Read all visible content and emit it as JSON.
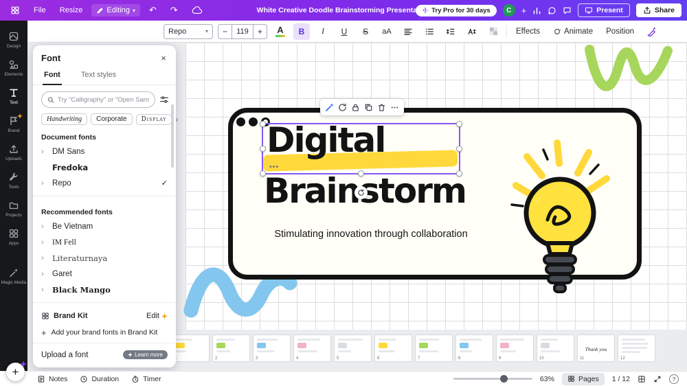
{
  "topbar": {
    "file": "File",
    "resize": "Resize",
    "editing": "Editing",
    "title": "White Creative Doodle Brainstorming Presentation",
    "try_pro": "Try Pro for 30 days",
    "avatar_initial": "C",
    "present": "Present",
    "share": "Share"
  },
  "toolbar": {
    "font_name": "Repo",
    "font_size": "119",
    "minus": "−",
    "plus": "+",
    "color_letter": "A",
    "bold": "B",
    "italic": "I",
    "underline": "U",
    "strikethrough": "S",
    "case_toggle": "aA",
    "effects": "Effects",
    "animate": "Animate",
    "position": "Position"
  },
  "font_panel": {
    "title": "Font",
    "tabs": {
      "font": "Font",
      "text_styles": "Text styles"
    },
    "search_placeholder": "Try \"Calligraphy\" or \"Open Sans\"",
    "chips": [
      {
        "label": "Handwriting"
      },
      {
        "label": "Corporate"
      },
      {
        "label": "Display"
      }
    ],
    "document_fonts_label": "Document fonts",
    "document_fonts": [
      {
        "name": "DM Sans"
      },
      {
        "name": "Fredoka"
      },
      {
        "name": "Repo",
        "selected": true
      }
    ],
    "recommended_label": "Recommended fonts",
    "recommended_fonts": [
      {
        "name": "Be Vietnam"
      },
      {
        "name": "IM Fell"
      },
      {
        "name": "Literaturnaya"
      },
      {
        "name": "Garet"
      },
      {
        "name": "Black Mango"
      }
    ],
    "brand_kit": {
      "label": "Brand Kit",
      "edit": "Edit"
    },
    "add_brand_fonts": "Add your brand fonts in Brand Kit",
    "upload": {
      "label": "Upload a font",
      "badge": "Learn more"
    }
  },
  "sidebar": {
    "items": [
      {
        "label": "Design"
      },
      {
        "label": "Elements"
      },
      {
        "label": "Text"
      },
      {
        "label": "Brand"
      },
      {
        "label": "Uploads"
      },
      {
        "label": "Tools"
      },
      {
        "label": "Projects"
      },
      {
        "label": "Apps"
      },
      {
        "label": "Magic Media"
      }
    ]
  },
  "canvas": {
    "title_line1": "Digital",
    "title_line2": "Brainstorm",
    "subtitle": "Stimulating innovation through collaboration"
  },
  "thumbnails": [
    {
      "n": "1"
    },
    {
      "n": "2"
    },
    {
      "n": "3"
    },
    {
      "n": "4"
    },
    {
      "n": "5"
    },
    {
      "n": "6"
    },
    {
      "n": "7"
    },
    {
      "n": "8"
    },
    {
      "n": "9"
    },
    {
      "n": "10"
    },
    {
      "n": "11",
      "label": "Thank you"
    },
    {
      "n": "12"
    }
  ],
  "statusbar": {
    "notes": "Notes",
    "duration": "Duration",
    "timer": "Timer",
    "zoom": "63%",
    "pages": "Pages",
    "page_indicator": "1 / 12"
  },
  "colors": {
    "accent": "#8b3dff",
    "highlight": "#ffd93b",
    "green": "#a6d65c",
    "blue": "#84c7ee",
    "selection": "#8457f6"
  }
}
